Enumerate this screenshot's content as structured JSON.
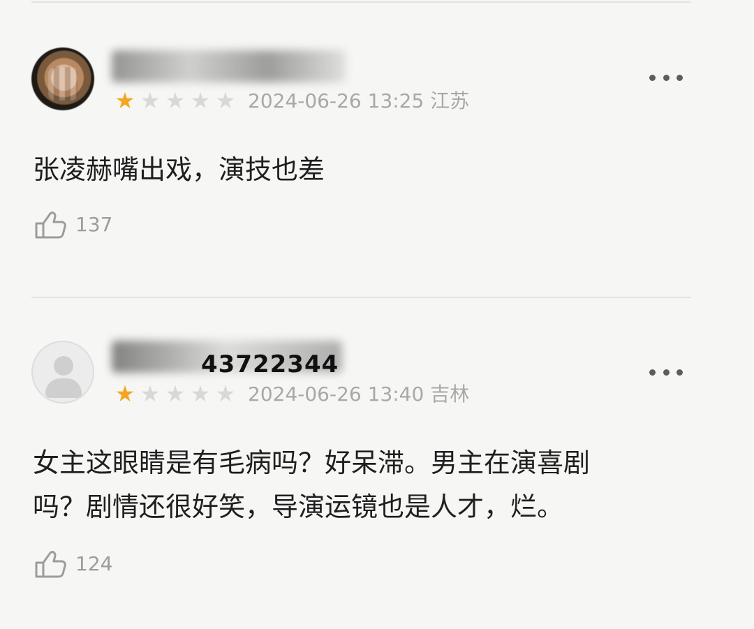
{
  "reviews": [
    {
      "username_display": "",
      "rating": 1,
      "stars": [
        "★",
        "★",
        "★",
        "★",
        "★"
      ],
      "meta": "2024-06-26 13:25 江苏",
      "content": "张凌赫嘴出戏，演技也差",
      "likes": "137",
      "more_icon": "more-horizontal-icon",
      "like_icon": "thumbs-up-icon"
    },
    {
      "username_display": "43722344",
      "rating": 1,
      "stars": [
        "★",
        "★",
        "★",
        "★",
        "★"
      ],
      "meta": "2024-06-26 13:40 吉林",
      "content": "女主这眼睛是有毛病吗？好呆滞。男主在演喜剧\n吗？剧情还很好笑，导演运镜也是人才，烂。",
      "likes": "124",
      "more_icon": "more-horizontal-icon",
      "like_icon": "thumbs-up-icon"
    }
  ],
  "colors": {
    "background": "#f6f6f4",
    "star_active": "#f4a521",
    "star_inactive": "#d8d8d8",
    "meta_text": "#a8a8a8",
    "divider": "#e3e3e1"
  }
}
